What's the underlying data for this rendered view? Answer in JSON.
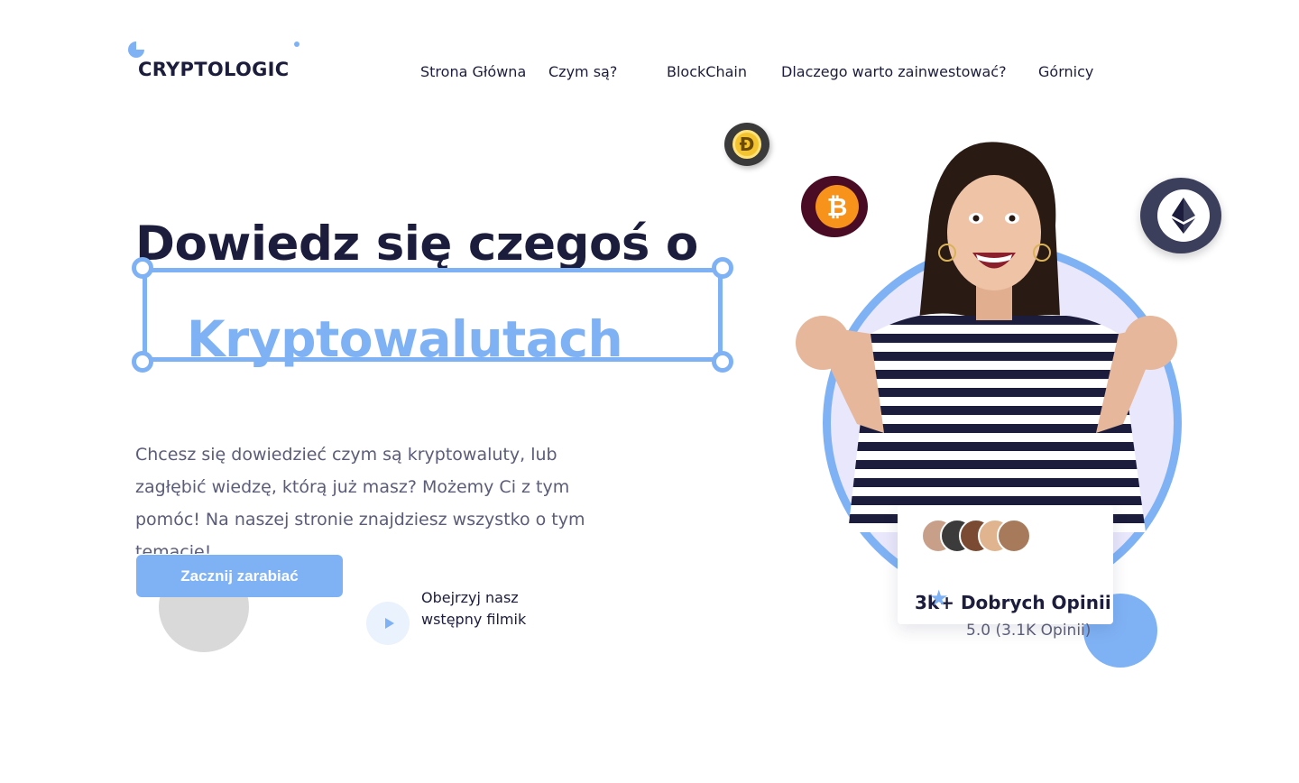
{
  "brand": {
    "name": "CRYPTOLOGIC"
  },
  "nav": {
    "items": [
      "Strona  Główna",
      "Czym są?",
      "BlockChain",
      "Dlaczego warto zainwestować?",
      "Górnicy"
    ]
  },
  "hero": {
    "title_line1": "Dowiedz się czegoś o",
    "title_line2": "Kryptowalutach",
    "description": "Chcesz się dowiedzieć czym są kryptowaluty, lub zagłębić wiedzę, którą już masz? Możemy Ci z tym pomóc! Na naszej stronie znajdziesz wszystko o tym temacie!",
    "cta_label": "Zacznij zarabiać",
    "video_label": "Obejrzyj nasz wstępny filmik"
  },
  "coins": {
    "doge_symbol": "Ð",
    "btc_symbol": "₿"
  },
  "reviews": {
    "title": "3k+ Dobrych Opinii",
    "subtitle": "5.0 (3.1K Opinii)",
    "avatar_count": 5
  },
  "colors": {
    "accent": "#7fb2f5",
    "dark": "#1c1d3c",
    "text_muted": "#5b5d78"
  }
}
